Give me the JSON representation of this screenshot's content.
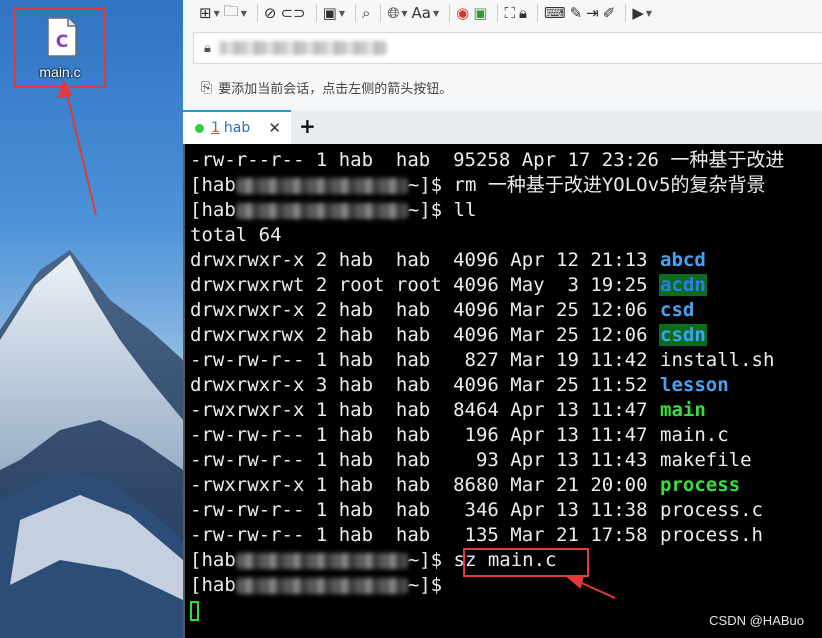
{
  "desktop": {
    "file_icon_letter": "C",
    "file_name": "main.c"
  },
  "session": {
    "hint_text": "要添加当前会话，点击左侧的箭头按钮。"
  },
  "tabs": [
    {
      "number": "1",
      "label": "hab",
      "status_color": "#2bcf3f"
    }
  ],
  "terminal": {
    "line0": "-rw-r--r-- 1 hab  hab  95258 Apr 17 23:26 一种基于改进",
    "prompt_user": "[hab",
    "prompt_tail": "~]$ ",
    "cmd_rm": "rm 一种基于改进YOLOv5的复杂背景",
    "cmd_ll": "ll",
    "total": "total 64",
    "listing": [
      {
        "meta": "drwxrwxr-x 2 hab  hab  4096 Apr 12 21:13 ",
        "name": "abcd",
        "kind": "dir"
      },
      {
        "meta": "drwxrwxrwt 2 root root 4096 May  3 19:25 ",
        "name": "acdn",
        "kind": "sticky"
      },
      {
        "meta": "drwxrwxr-x 2 hab  hab  4096 Mar 25 12:06 ",
        "name": "csd",
        "kind": "dir"
      },
      {
        "meta": "drwxrwxrwx 2 hab  hab  4096 Mar 25 12:06 ",
        "name": "csdn",
        "kind": "ow"
      },
      {
        "meta": "-rw-rw-r-- 1 hab  hab   827 Mar 19 11:42 ",
        "name": "install.sh",
        "kind": "file"
      },
      {
        "meta": "drwxrwxr-x 3 hab  hab  4096 Mar 25 11:52 ",
        "name": "lesson",
        "kind": "dir"
      },
      {
        "meta": "-rwxrwxr-x 1 hab  hab  8464 Apr 13 11:47 ",
        "name": "main",
        "kind": "exe"
      },
      {
        "meta": "-rw-rw-r-- 1 hab  hab   196 Apr 13 11:47 ",
        "name": "main.c",
        "kind": "file"
      },
      {
        "meta": "-rw-rw-r-- 1 hab  hab    93 Apr 13 11:43 ",
        "name": "makefile",
        "kind": "file"
      },
      {
        "meta": "-rwxrwxr-x 1 hab  hab  8680 Mar 21 20:00 ",
        "name": "process",
        "kind": "exe"
      },
      {
        "meta": "-rw-rw-r-- 1 hab  hab   346 Apr 13 11:38 ",
        "name": "process.c",
        "kind": "file"
      },
      {
        "meta": "-rw-rw-r-- 1 hab  hab   135 Mar 21 17:58 ",
        "name": "process.h",
        "kind": "file"
      }
    ],
    "cmd_sz": "sz main.c"
  },
  "watermark": "CSDN @HABuo",
  "colors": {
    "annotation_red": "#e03a3a",
    "directory_blue": "#4aa2f2",
    "executable_green": "#34e13b",
    "cursor_green": "#2bdc3a"
  }
}
